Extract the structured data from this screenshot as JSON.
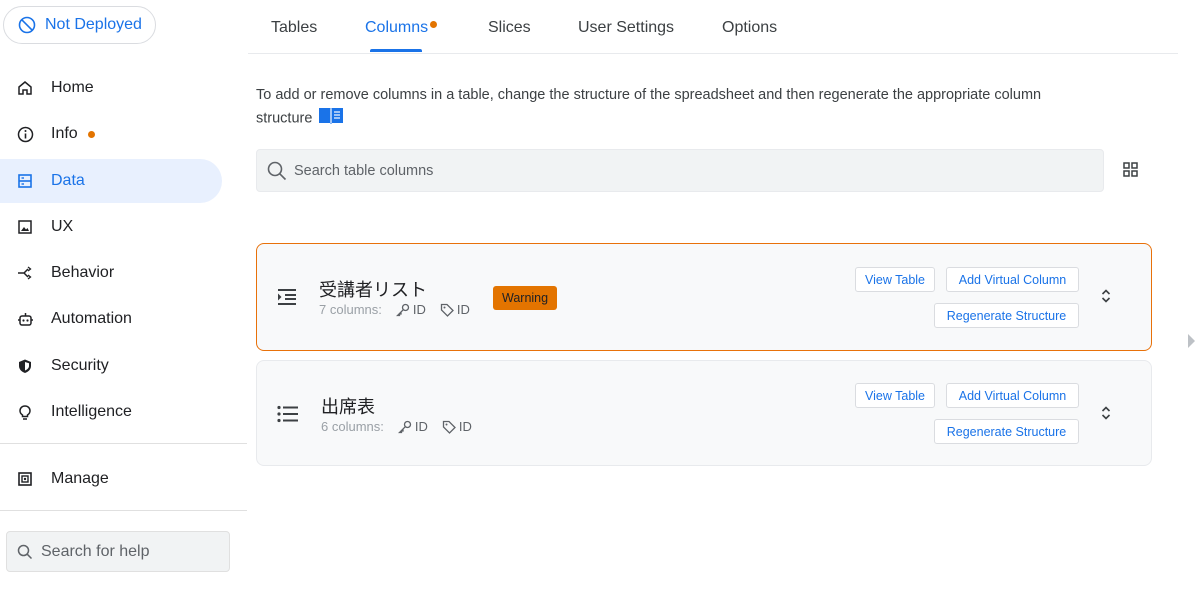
{
  "deploy_status": "Not Deployed",
  "sidebar": {
    "items": [
      {
        "label": "Home",
        "icon": "home-icon"
      },
      {
        "label": "Info",
        "icon": "info-icon"
      },
      {
        "label": "Data",
        "icon": "data-icon"
      },
      {
        "label": "UX",
        "icon": "ux-icon"
      },
      {
        "label": "Behavior",
        "icon": "behavior-icon"
      },
      {
        "label": "Automation",
        "icon": "automation-icon"
      },
      {
        "label": "Security",
        "icon": "security-icon"
      },
      {
        "label": "Intelligence",
        "icon": "intelligence-icon"
      }
    ],
    "manage": "Manage",
    "help_placeholder": "Search for help"
  },
  "tabs": [
    "Tables",
    "Columns",
    "Slices",
    "User Settings",
    "Options"
  ],
  "active_tab": "Columns",
  "main": {
    "info": "To add or remove columns in a table, change the structure of the spreadsheet and then regenerate the appropriate column structure",
    "search_placeholder": "Search table columns",
    "tables": [
      {
        "name": "受講者リスト",
        "columns_text": "7 columns:",
        "key_label": "ID",
        "label_label": "ID",
        "badge": "Warning",
        "view_btn": "View Table",
        "add_btn": "Add Virtual Column",
        "regen_btn": "Regenerate Structure"
      },
      {
        "name": "出席表",
        "columns_text": "6 columns:",
        "key_label": "ID",
        "label_label": "ID",
        "view_btn": "View Table",
        "add_btn": "Add Virtual Column",
        "regen_btn": "Regenerate Structure"
      }
    ]
  },
  "colors": {
    "accent": "#1a73e8",
    "warning": "#e37400",
    "active_bg": "#e8f0fe"
  }
}
